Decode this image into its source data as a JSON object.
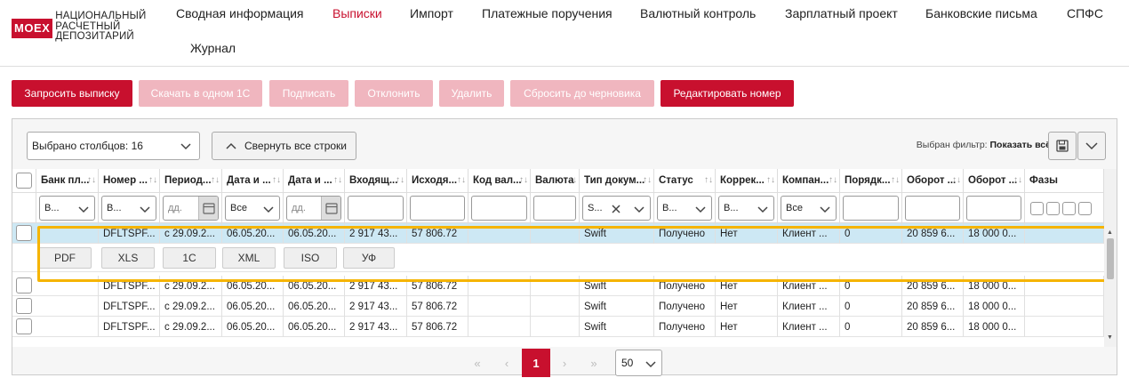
{
  "logo": {
    "badge": "MOEX",
    "line1": "НАЦИОНАЛЬНЫЙ",
    "line2": "РАСЧЕТНЫЙ",
    "line3": "ДЕПОЗИТАРИЙ"
  },
  "nav": [
    "Сводная информация",
    "Выписки",
    "Импорт",
    "Платежные поручения",
    "Валютный контроль",
    "Зарплатный проект",
    "Банковские письма",
    "СПФС",
    "Журнал"
  ],
  "toolbar": [
    "Запросить выписку",
    "Скачать в одном 1С",
    "Подписать",
    "Отклонить",
    "Удалить",
    "Сбросить до черновика",
    "Редактировать номер"
  ],
  "grid": {
    "columns_select": "Выбрано столбцов: 16",
    "collapse_label": "Свернуть все строки",
    "filter_label": "Выбран фильтр:",
    "filter_value": "Показать всё"
  },
  "headers": [
    "Банк пл...",
    "Номер ...",
    "Период...",
    "Дата и ...",
    "Дата и ...",
    "Входящ...",
    "Исходя...",
    "Код вал...",
    "Валюта",
    "Тип докум...",
    "Статус",
    "Коррек...",
    "Компан...",
    "Порядк...",
    "Оборот ...",
    "Оборот ...",
    "Фазы"
  ],
  "filters": {
    "bank": "В...",
    "number": "В...",
    "period": "дд.",
    "date1": "Все",
    "date2": "дд.",
    "doctype": "S...",
    "status": "В...",
    "correction": "В...",
    "company": "Все"
  },
  "rows": [
    [
      "",
      "DFLTSPF...",
      "с 29.09.2...",
      "06.05.20...",
      "06.05.20...",
      "2 917 43...",
      "57 806.72",
      "",
      "",
      "Swift",
      "Получено",
      "Нет",
      "Клиент ...",
      "0",
      "20 859 6...",
      "18 000 0...",
      ""
    ],
    [
      "",
      "DFLTSPF...",
      "с 29.09.2...",
      "06.05.20...",
      "06.05.20...",
      "2 917 43...",
      "57 806.72",
      "",
      "",
      "Swift",
      "Получено",
      "Нет",
      "Клиент ...",
      "0",
      "20 859 6...",
      "18 000 0...",
      ""
    ],
    [
      "",
      "DFLTSPF...",
      "с 29.09.2...",
      "06.05.20...",
      "06.05.20...",
      "2 917 43...",
      "57 806.72",
      "",
      "",
      "Swift",
      "Получено",
      "Нет",
      "Клиент ...",
      "0",
      "20 859 6...",
      "18 000 0...",
      ""
    ],
    [
      "",
      "DFLTSPF...",
      "с 29.09.2...",
      "06.05.20...",
      "06.05.20...",
      "2 917 43...",
      "57 806.72",
      "",
      "",
      "Swift",
      "Получено",
      "Нет",
      "Клиент ...",
      "0",
      "20 859 6...",
      "18 000 0...",
      ""
    ]
  ],
  "export_buttons": [
    "PDF",
    "XLS",
    "1С",
    "XML",
    "ISO",
    "УФ"
  ],
  "pager": {
    "first": "«",
    "prev": "‹",
    "current": "1",
    "next": "›",
    "last": "»",
    "page_size": "50"
  },
  "colors": {
    "accent": "#c8102e",
    "disabled": "#f0b6bf",
    "selected_row": "#cde8f4",
    "highlight": "#f5b400"
  }
}
